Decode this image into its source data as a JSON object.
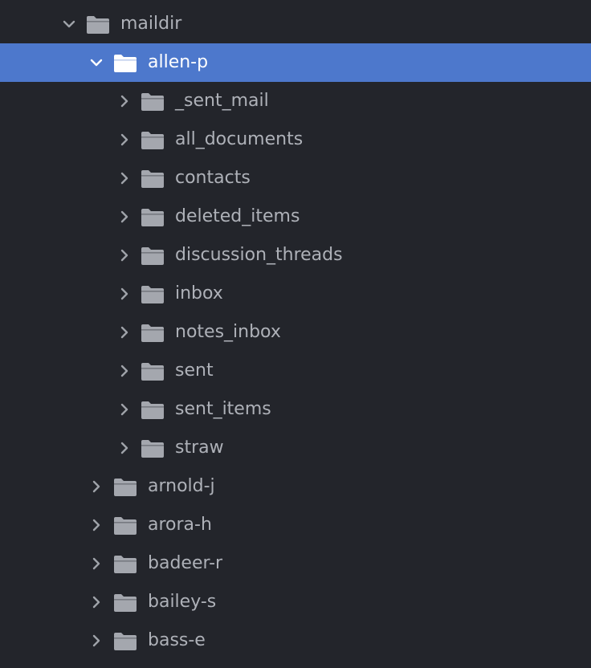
{
  "colors": {
    "background": "#23252b",
    "text": "#aeb1b8",
    "selected_background": "#4d78cc",
    "selected_text": "#ffffff",
    "folder": "#a4a7ae",
    "chevron": "#9fa2a9"
  },
  "icons": {
    "chevron_expanded": "chevron-down-icon",
    "chevron_collapsed": "chevron-right-icon",
    "folder": "folder-icon"
  },
  "tree": {
    "root": {
      "label": "maildir",
      "expanded": true
    },
    "selected": {
      "label": "allen-p",
      "expanded": true
    },
    "allen_children": [
      {
        "label": "_sent_mail"
      },
      {
        "label": "all_documents"
      },
      {
        "label": "contacts"
      },
      {
        "label": "deleted_items"
      },
      {
        "label": "discussion_threads"
      },
      {
        "label": "inbox"
      },
      {
        "label": "notes_inbox"
      },
      {
        "label": "sent"
      },
      {
        "label": "sent_items"
      },
      {
        "label": "straw"
      }
    ],
    "siblings": [
      {
        "label": "arnold-j"
      },
      {
        "label": "arora-h"
      },
      {
        "label": "badeer-r"
      },
      {
        "label": "bailey-s"
      },
      {
        "label": "bass-e"
      }
    ]
  }
}
